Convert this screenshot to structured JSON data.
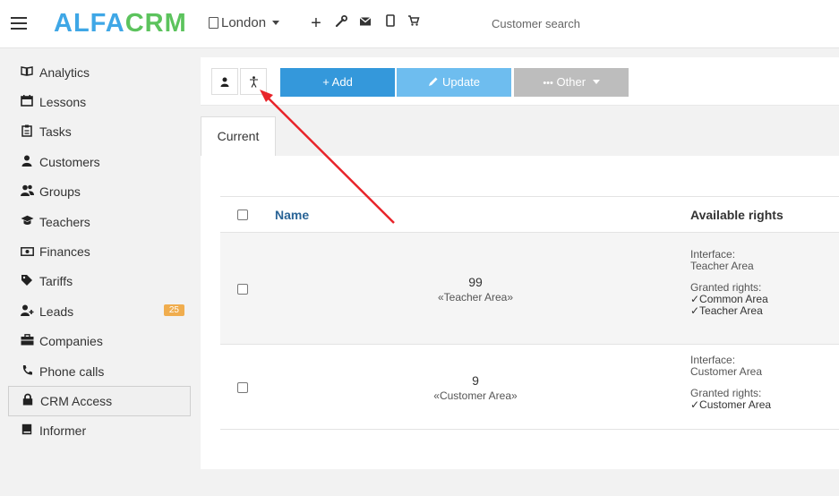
{
  "header": {
    "logo_part1": "ALFA",
    "logo_part2": "CRM",
    "branch": "London",
    "search_placeholder": "Customer search"
  },
  "sidebar": {
    "items": [
      {
        "label": "Analytics",
        "icon": "book-icon"
      },
      {
        "label": "Lessons",
        "icon": "calendar-icon"
      },
      {
        "label": "Tasks",
        "icon": "clipboard-icon"
      },
      {
        "label": "Customers",
        "icon": "user-icon"
      },
      {
        "label": "Groups",
        "icon": "users-icon"
      },
      {
        "label": "Teachers",
        "icon": "graduation-cap-icon"
      },
      {
        "label": "Finances",
        "icon": "money-icon"
      },
      {
        "label": "Tariffs",
        "icon": "tag-icon"
      },
      {
        "label": "Leads",
        "icon": "user-plus-icon",
        "badge": "25"
      },
      {
        "label": "Companies",
        "icon": "briefcase-icon"
      },
      {
        "label": "Phone calls",
        "icon": "phone-icon"
      },
      {
        "label": "CRM Access",
        "icon": "lock-icon",
        "active": true
      },
      {
        "label": "Informer",
        "icon": "book-closed-icon"
      }
    ]
  },
  "toolbar": {
    "add_label": "+ Add",
    "update_label": "Update",
    "other_label": "Other"
  },
  "tabs": {
    "current": "Current"
  },
  "table": {
    "headers": {
      "name": "Name",
      "rights": "Available rights"
    },
    "rows": [
      {
        "number": "99",
        "area": "«Teacher Area»",
        "interface_label": "Interface:",
        "interface_value": "Teacher Area",
        "granted_label": "Granted rights:",
        "granted": [
          "✓Common Area",
          "✓Teacher Area"
        ]
      },
      {
        "number": "9",
        "area": "«Customer Area»",
        "interface_label": "Interface:",
        "interface_value": "Customer Area",
        "granted_label": "Granted rights:",
        "granted": [
          "✓Customer Area"
        ]
      }
    ]
  },
  "colors": {
    "accent_blue": "#3498db",
    "update_blue": "#6ebdef",
    "other_gray": "#bdbdbd",
    "badge_orange": "#f0ad4e",
    "arrow_red": "#e8242a"
  }
}
